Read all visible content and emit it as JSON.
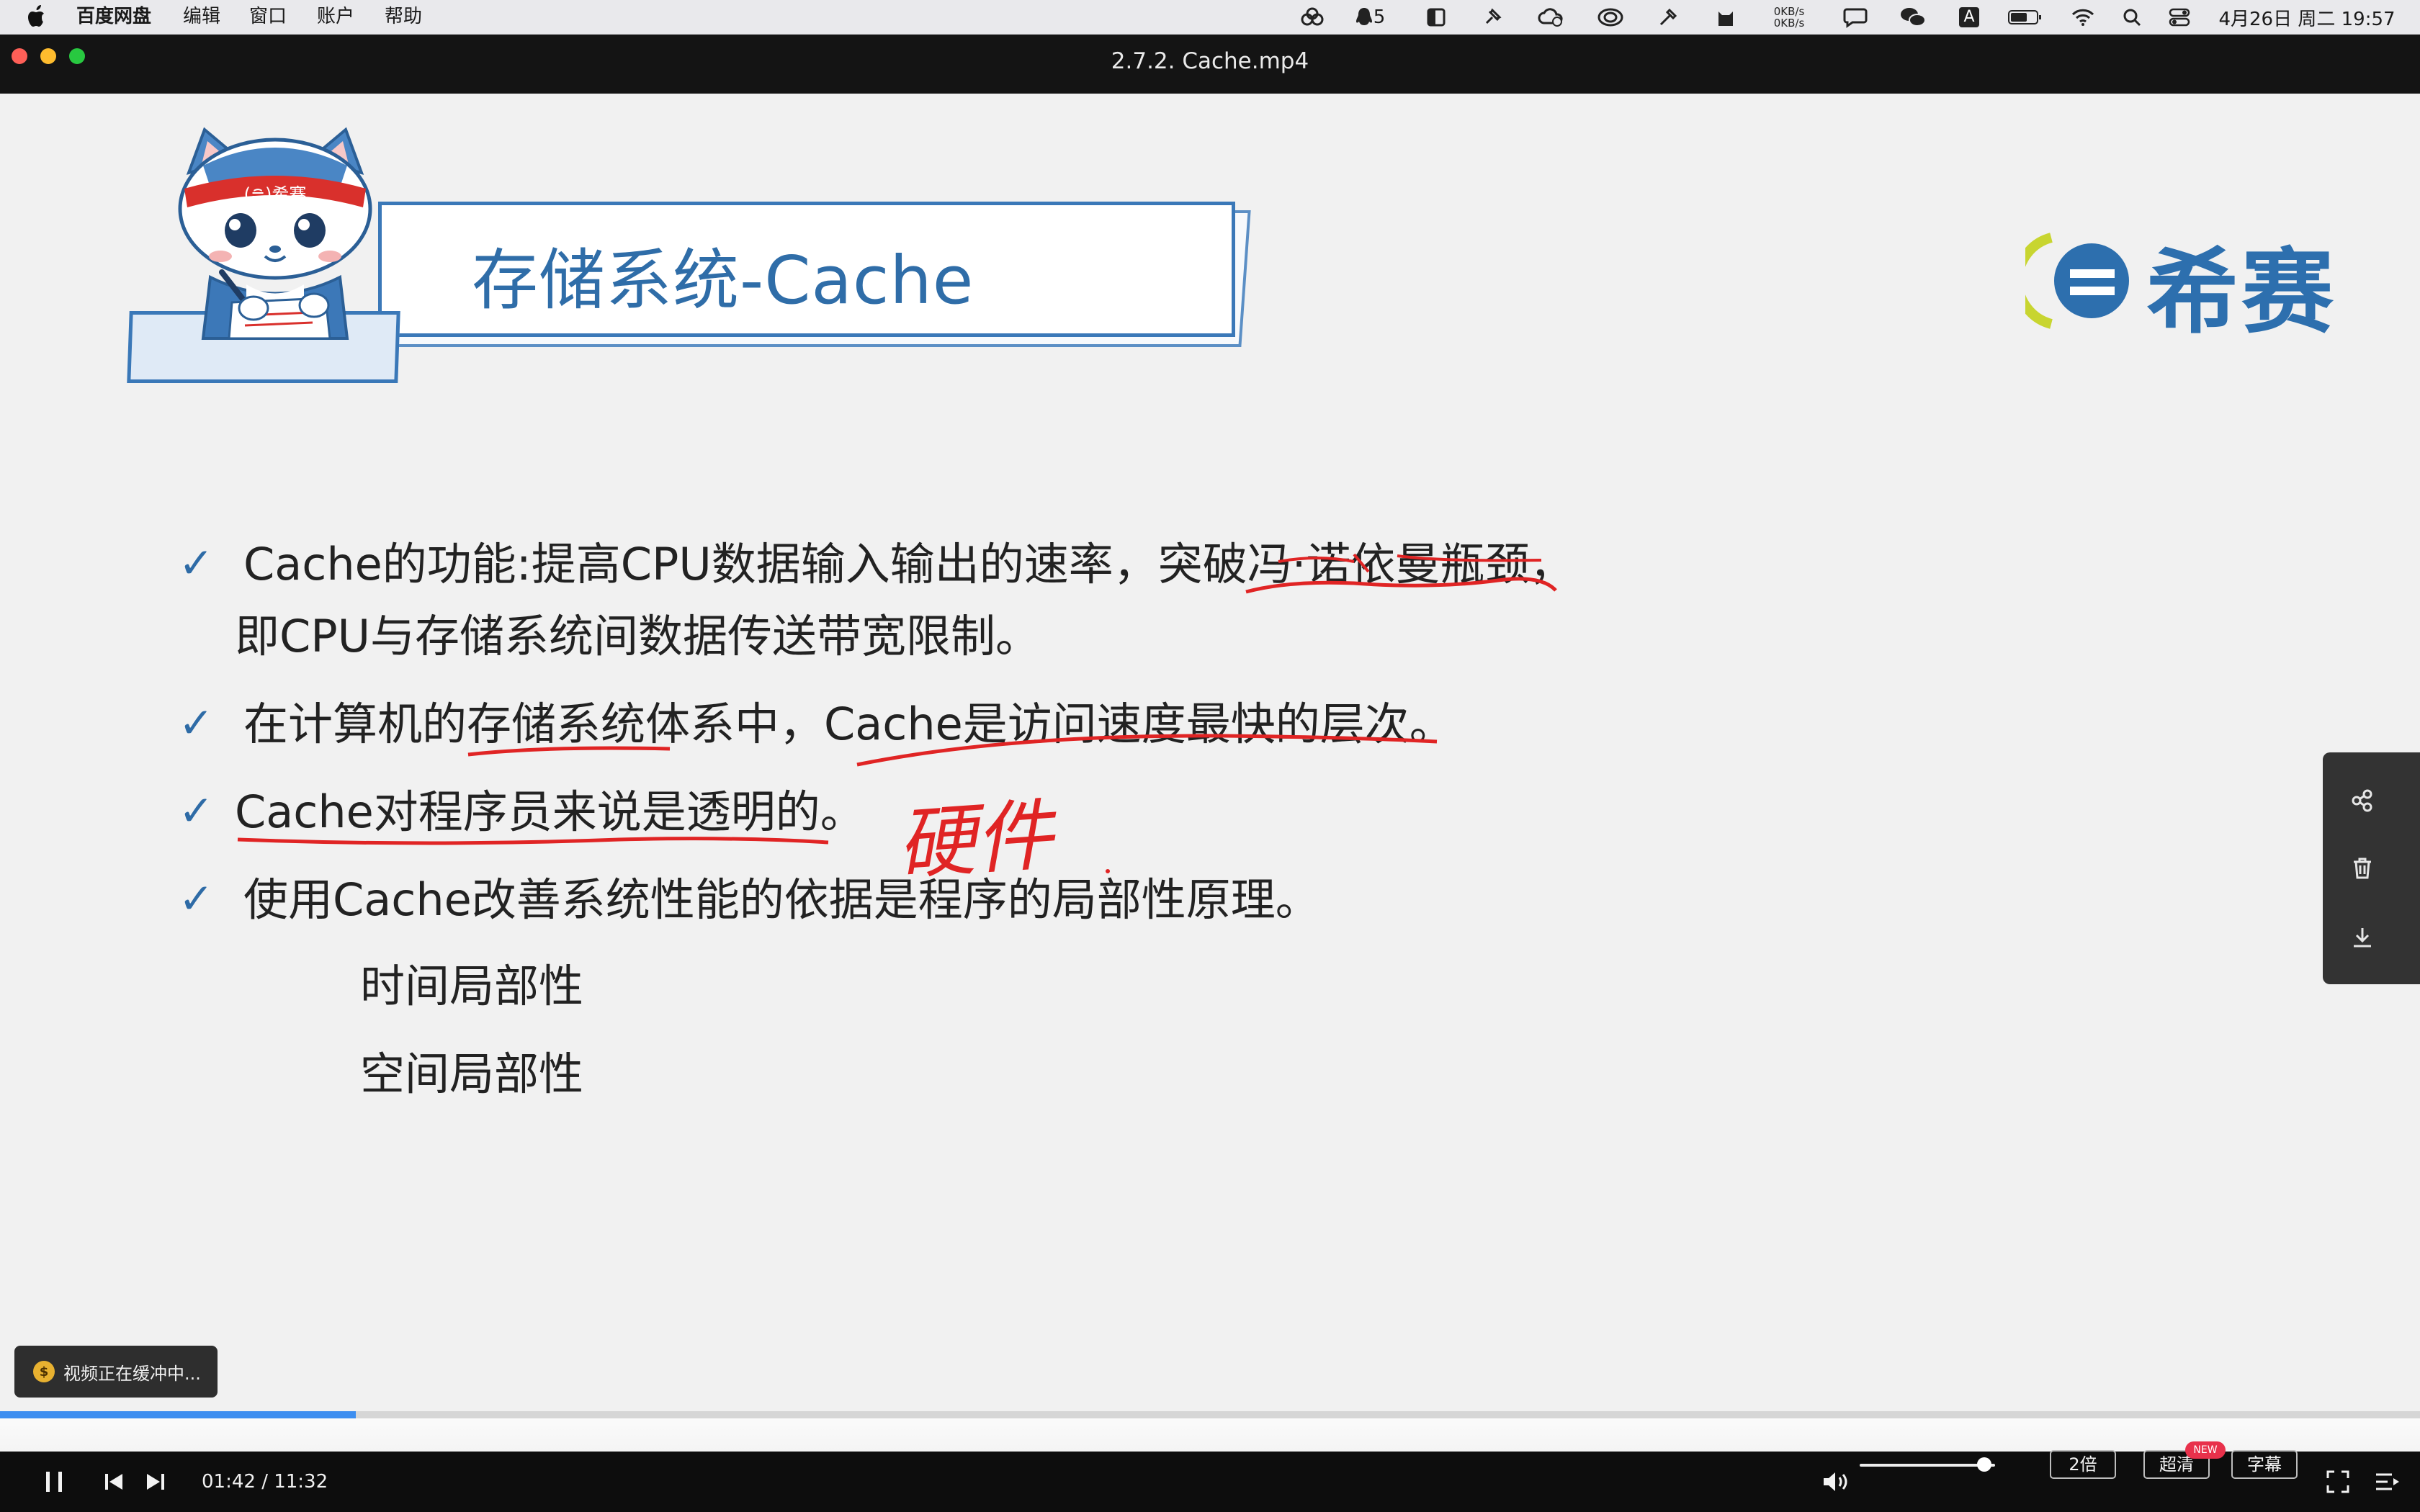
{
  "menubar": {
    "app_name": "百度网盘",
    "items": [
      "编辑",
      "窗口",
      "账户",
      "帮助"
    ],
    "notification_count": "5",
    "net_up": "0KB/s",
    "net_down": "0KB/s",
    "ime_label": "A",
    "clock": "4月26日 周二 19:57"
  },
  "window": {
    "title": "2.7.2. Cache.mp4"
  },
  "slide": {
    "title": "存储系统-Cache",
    "logo_text": "希赛",
    "mascot_headband": "(≘)希赛",
    "bullets": [
      "Cache的功能:提高CPU数据输入输出的速率，突破冯·诺依曼瓶颈，",
      "即CPU与存储系统间数据传送带宽限制。",
      "在计算机的存储系统体系中，Cache是访问速度最快的层次。",
      "Cache对程序员来说是透明的。",
      "使用Cache改善系统性能的依据是程序的局部性原理。"
    ],
    "sub_items": [
      "时间局部性",
      "空间局部性"
    ],
    "handwritten_note": "硬件"
  },
  "side_panel": {
    "icons": [
      "share-icon",
      "trash-icon",
      "download-icon"
    ]
  },
  "player": {
    "buffer_message": "视频正在缓冲中...",
    "current_time": "01:42",
    "total_time": "11:32",
    "time_display": "01:42 / 11:32",
    "progress_fraction": 0.147,
    "volume_fraction": 0.92,
    "speed_label": "2倍",
    "quality_label": "超清",
    "new_badge": "NEW",
    "subtitle_label": "字幕"
  },
  "colors": {
    "accent": "#3d8ef0",
    "slide_blue": "#2f6da8",
    "annotation_red": "#e02424"
  }
}
